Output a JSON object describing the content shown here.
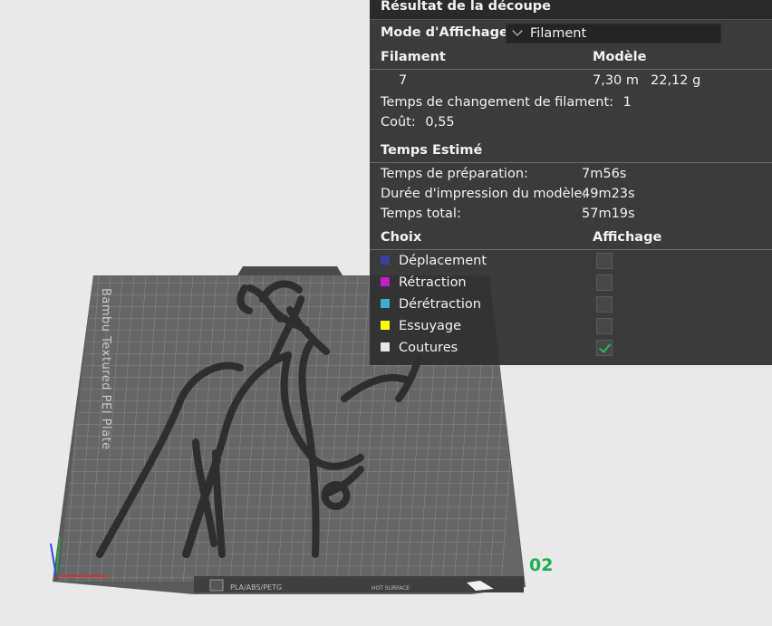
{
  "viewport": {
    "plate_number": "02",
    "bed_text": "Bambu Textured PEI Plate",
    "bed_footer": "PLA/ABS/PETG",
    "bed_footer_right": "HOT SURFACE"
  },
  "panel": {
    "title": "Résultat de la découpe",
    "display_mode_label": "Mode d'Affichage",
    "display_mode_value": "Filament",
    "filament_header": "Filament",
    "model_header": "Modèle",
    "filament": {
      "id": "7",
      "length": "7,30 m",
      "weight": "22,12 g",
      "color": "#3a3a3a"
    },
    "change_label": "Temps de changement de filament:",
    "change_value": "1",
    "cost_label": "Coût:",
    "cost_value": "0,55",
    "estimated_header": "Temps Estimé",
    "times": [
      {
        "label": "Temps de préparation:",
        "value": "7m56s"
      },
      {
        "label": "Durée d'impression du modèle:",
        "value": "49m23s"
      },
      {
        "label": "Temps total:",
        "value": "57m19s"
      }
    ],
    "choice_header": "Choix",
    "display_header": "Affichage",
    "options": [
      {
        "label": "Déplacement",
        "color": "#3c3fa0",
        "checked": false
      },
      {
        "label": "Rétraction",
        "color": "#c31ec8",
        "checked": false
      },
      {
        "label": "Dérétraction",
        "color": "#3ab0c9",
        "checked": false
      },
      {
        "label": "Essuyage",
        "color": "#ffff00",
        "checked": false
      },
      {
        "label": "Coutures",
        "color": "#e6e6e6",
        "checked": true
      }
    ]
  }
}
